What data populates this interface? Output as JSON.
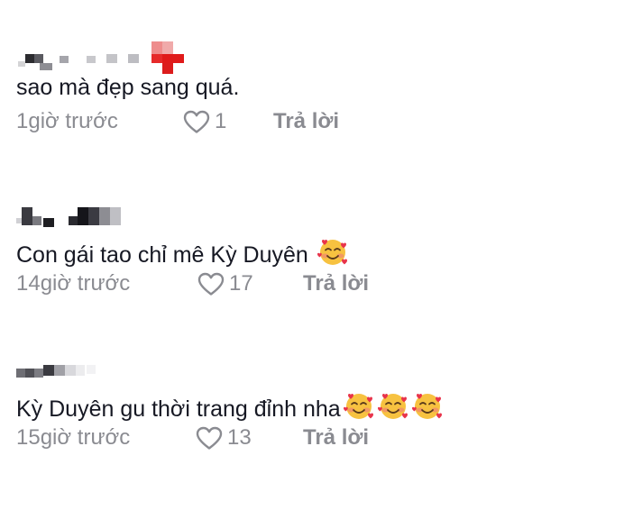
{
  "comments": [
    {
      "text": "sao mà đẹp sang quá.",
      "time": "1giờ trước",
      "likes": "1",
      "reply_label": "Trả lời",
      "emoji_count": 0
    },
    {
      "text": "Con gái tao chỉ mê Kỳ Duyên",
      "time": "14giờ trước",
      "likes": "17",
      "reply_label": "Trả lời",
      "emoji_count": 1
    },
    {
      "text": "Kỳ Duyên gu thời trang đỉnh nha",
      "time": "15giờ trước",
      "likes": "13",
      "reply_label": "Trả lời",
      "emoji_count": 3
    }
  ],
  "icons": {
    "like": "heart-outline-icon",
    "emoji": "smiling-face-with-hearts-emoji"
  },
  "colors": {
    "text": "#161823",
    "meta": "#8a8b91",
    "emoji_face": "#f7c240",
    "emoji_heart": "#e8334a"
  }
}
